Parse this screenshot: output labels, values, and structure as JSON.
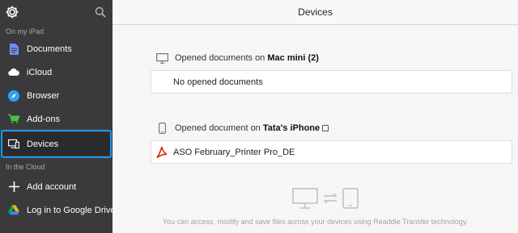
{
  "sidebar": {
    "top": {
      "settings_icon": "gear-icon",
      "search_icon": "search-icon"
    },
    "sections": [
      {
        "label": "On my iPad",
        "items": [
          {
            "label": "Documents",
            "icon": "document-icon",
            "color": "#6e8ff5"
          },
          {
            "label": "iCloud",
            "icon": "cloud-icon",
            "color": "#ffffff"
          },
          {
            "label": "Browser",
            "icon": "compass-icon",
            "color": "#2aa5f3"
          },
          {
            "label": "Add-ons",
            "icon": "cart-icon",
            "color": "#44c43e"
          },
          {
            "label": "Devices",
            "icon": "devices-icon",
            "color": "#ffffff",
            "active": true
          }
        ]
      },
      {
        "label": "In the Cloud",
        "items": [
          {
            "label": "Add account",
            "icon": "plus-icon",
            "color": "#ffffff"
          },
          {
            "label": "Log in to Google Drive",
            "icon": "google-drive-icon",
            "color": "#f4b400"
          }
        ]
      }
    ]
  },
  "main": {
    "title": "Devices",
    "groups": [
      {
        "heading_prefix": "Opened documents on ",
        "device": "Mac mini (2)",
        "icon": "monitor-icon",
        "rows": [
          "No opened documents"
        ]
      },
      {
        "heading_prefix": "Opened document on ",
        "device": "Tata's iPhone",
        "icon": "phone-icon",
        "rows": [
          "ASO February_Printer Pro_DE"
        ]
      }
    ],
    "footnote": "You can access, modify and save files across your devices using Readdle Transfer technology."
  },
  "colors": {
    "accent": "#1a9bf0",
    "pdf": "#e2231a",
    "sidebar_bg": "#3a3a3c"
  }
}
